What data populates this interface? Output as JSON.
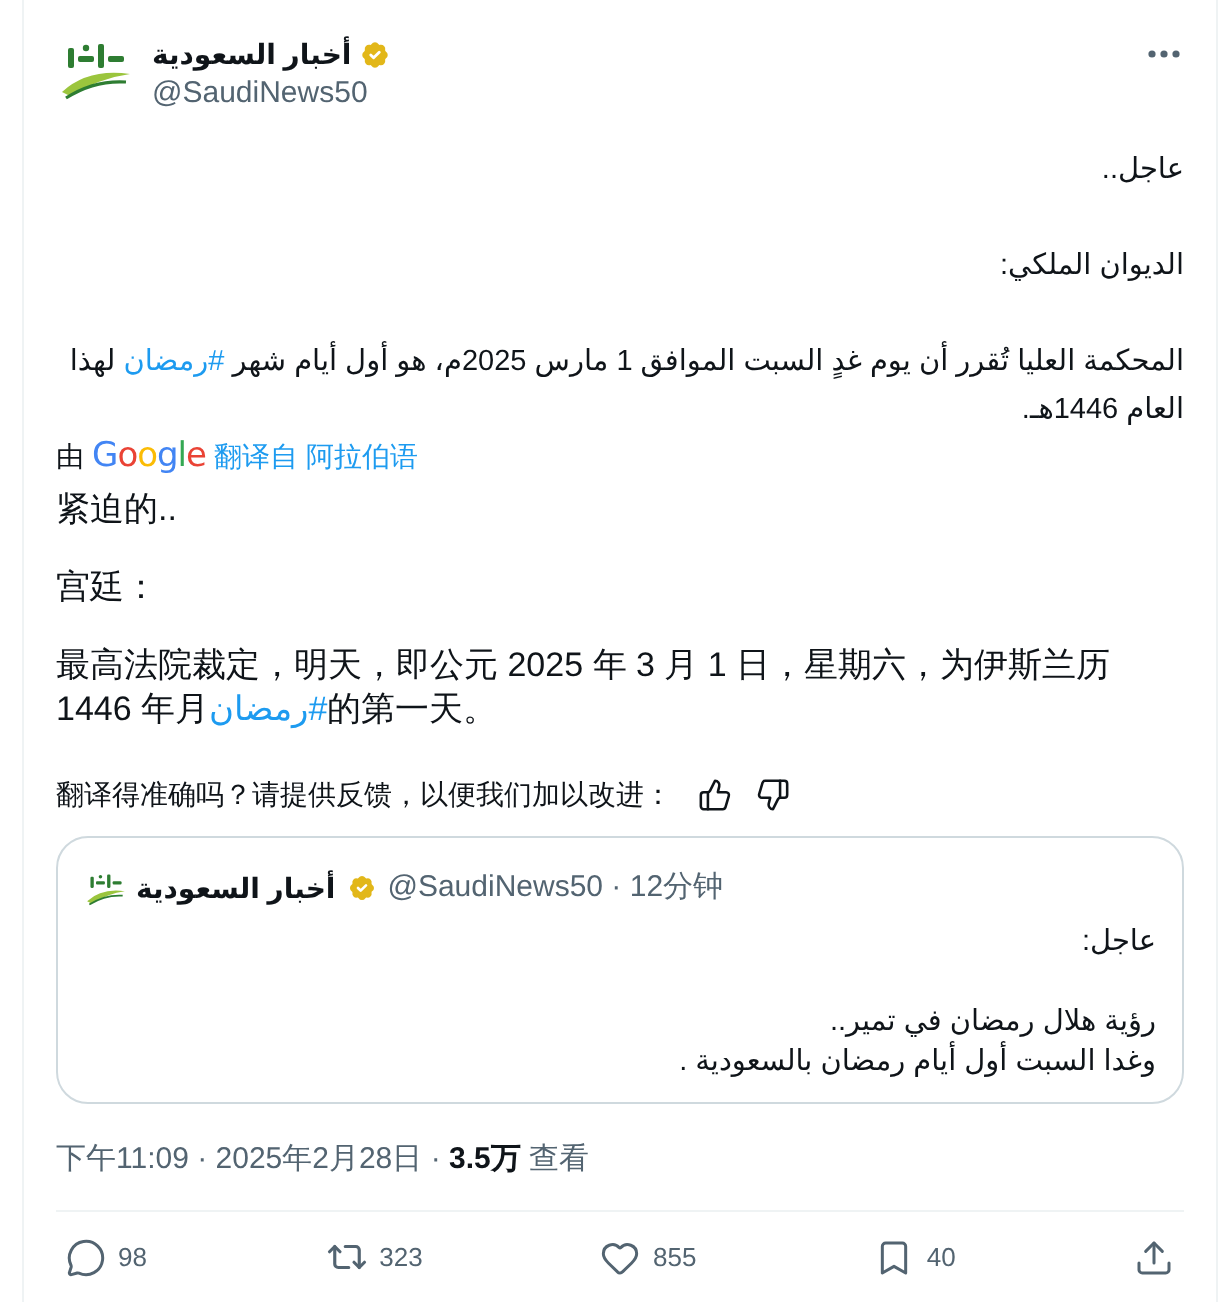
{
  "tweet": {
    "author": {
      "name": "أخبار السعودية",
      "verified": true,
      "handle": "@SaudiNews50"
    },
    "text": [
      {
        "lines": [
          {
            "text": "عاجل.."
          }
        ]
      },
      {
        "lines": [
          {
            "text": "الديوان الملكي:"
          }
        ]
      },
      {
        "lines": [
          {
            "text": "المحكمة العليا تُقرر أن يوم غدٍ السبت الموافق 1 مارس 2025م، هو أول أيام شهر ",
            "hashtag": "#رمضان",
            "text_after": " لهذا"
          },
          {
            "text": "العام 1446هـ."
          }
        ]
      }
    ],
    "translation": {
      "prefix": "由",
      "provider": "Google",
      "link": "翻译自 阿拉伯语"
    },
    "translated_text": [
      {
        "lines": [
          {
            "text": "紧迫的.."
          }
        ]
      },
      {
        "lines": [
          {
            "text": "宫廷："
          }
        ]
      },
      {
        "lines": [
          {
            "text": "最高法院裁定，明天，即公元 2025 年 3 月 1 日，星期六，为伊斯兰历"
          },
          {
            "text": "1446 年月",
            "hashtag": "#رمضان",
            "text_after": "的第一天。"
          }
        ]
      }
    ],
    "feedback": {
      "prompt": "翻译得准确吗？请提供反馈，以便我们加以改进："
    },
    "quote": {
      "author": {
        "name": "أخبار السعودية",
        "verified": true,
        "byline": "@SaudiNews50 · 12分钟"
      },
      "text": [
        {
          "lines": [
            "عاجل:"
          ]
        },
        {
          "lines": [
            "رؤية هلال رمضان في تمير..",
            "وغدا السبت أول أيام رمضان بالسعودية ."
          ]
        }
      ]
    },
    "timestamp": "下午11:09 · 2025年2月28日 · **3.5万** 查看",
    "actions": {
      "reply": {
        "count": "98"
      },
      "repost": {
        "count": "323"
      },
      "like": {
        "count": "855"
      },
      "bookmark": {
        "count": "40"
      }
    }
  }
}
